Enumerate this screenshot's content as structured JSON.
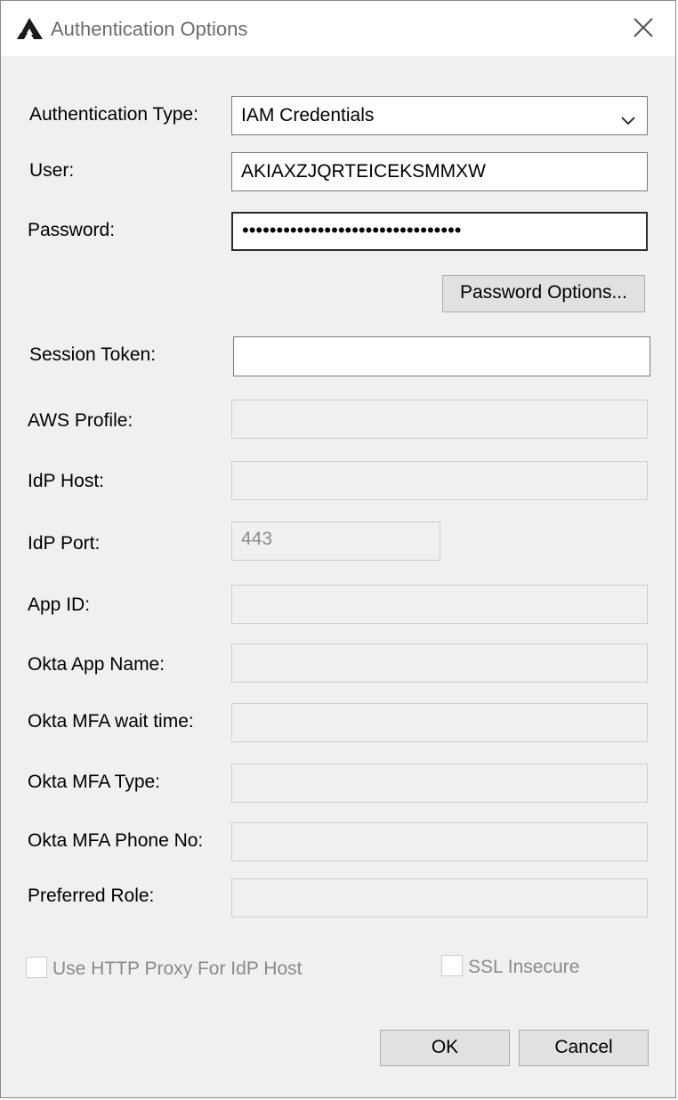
{
  "window": {
    "title": "Authentication Options",
    "icon": "app-logo-icon",
    "close_icon": "close-icon"
  },
  "form": {
    "auth_type": {
      "label": "Authentication Type:",
      "value": "IAM Credentials"
    },
    "user": {
      "label": "User:",
      "value": "AKIAXZJQRTEICEKSMMXW"
    },
    "password": {
      "label": "Password:",
      "value": "••••••••••••••••••••••••••••••••"
    },
    "password_options_label": "Password Options...",
    "session_token": {
      "label": "Session Token:",
      "value": ""
    },
    "aws_profile": {
      "label": "AWS Profile:",
      "value": ""
    },
    "idp_host": {
      "label": "IdP Host:",
      "value": ""
    },
    "idp_port": {
      "label": "IdP Port:",
      "value": "443"
    },
    "app_id": {
      "label": "App ID:",
      "value": ""
    },
    "okta_app_name": {
      "label": "Okta App Name:",
      "value": ""
    },
    "okta_mfa_wait": {
      "label": "Okta MFA wait time:",
      "value": ""
    },
    "okta_mfa_type": {
      "label": "Okta MFA Type:",
      "value": ""
    },
    "okta_mfa_phone": {
      "label": "Okta MFA Phone No:",
      "value": ""
    },
    "preferred_role": {
      "label": "Preferred Role:",
      "value": ""
    },
    "use_http_proxy": {
      "label": "Use HTTP Proxy For IdP Host",
      "checked": false
    },
    "ssl_insecure": {
      "label": "SSL Insecure",
      "checked": false
    }
  },
  "buttons": {
    "ok": "OK",
    "cancel": "Cancel"
  }
}
